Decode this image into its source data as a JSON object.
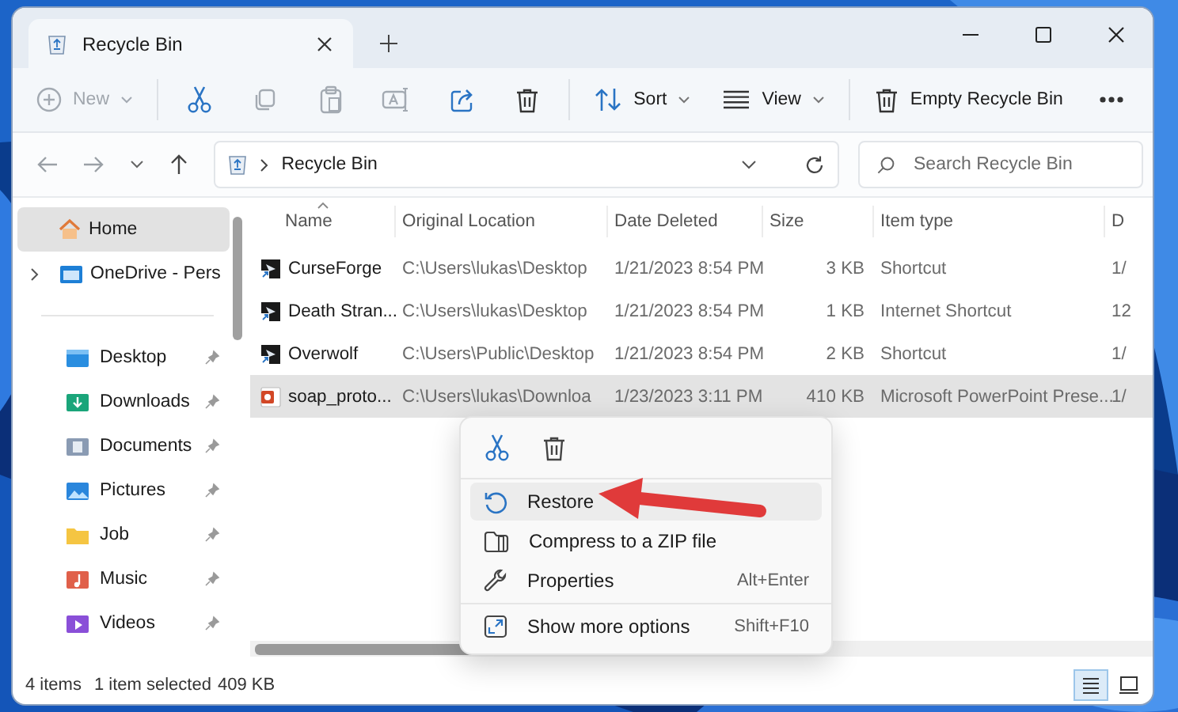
{
  "window": {
    "tab": {
      "title": "Recycle Bin"
    }
  },
  "toolbar": {
    "items": [
      {
        "kind": "new",
        "label": "New",
        "disabled": true
      },
      {
        "kind": "cut",
        "disabled": false
      },
      {
        "kind": "copy",
        "disabled": true
      },
      {
        "kind": "paste",
        "disabled": true
      },
      {
        "kind": "rename",
        "disabled": true
      },
      {
        "kind": "share",
        "disabled": false
      },
      {
        "kind": "delete",
        "disabled": false
      },
      {
        "kind": "sort",
        "label": "Sort",
        "disabled": false
      },
      {
        "kind": "view",
        "label": "View",
        "disabled": false
      },
      {
        "kind": "empty",
        "label": "Empty Recycle Bin",
        "disabled": false
      },
      {
        "kind": "more",
        "disabled": false
      }
    ]
  },
  "address_bar": {
    "path": [
      "Recycle Bin"
    ],
    "search": {
      "placeholder": "Search Recycle Bin"
    }
  },
  "sidebar": {
    "items": [
      {
        "kind": "home",
        "label": "Home",
        "selected": true,
        "pinned": false
      },
      {
        "kind": "cloud",
        "label": "OneDrive - Pers",
        "selected": false,
        "pinned": false,
        "expanded": false
      },
      {
        "kind": "desktop",
        "label": "Desktop",
        "selected": false,
        "pinned": true
      },
      {
        "kind": "downloads",
        "label": "Downloads",
        "selected": false,
        "pinned": true
      },
      {
        "kind": "documents",
        "label": "Documents",
        "selected": false,
        "pinned": true
      },
      {
        "kind": "pictures",
        "label": "Pictures",
        "selected": false,
        "pinned": true
      },
      {
        "kind": "folder",
        "label": "Job",
        "selected": false,
        "pinned": true
      },
      {
        "kind": "music",
        "label": "Music",
        "selected": false,
        "pinned": true
      },
      {
        "kind": "videos",
        "label": "Videos",
        "selected": false,
        "pinned": true
      }
    ]
  },
  "table": {
    "columns": [
      "Name",
      "Original Location",
      "Date Deleted",
      "Size",
      "Item type",
      "D"
    ],
    "rows": [
      {
        "kind": "shortcut",
        "cells": [
          "CurseForge",
          "C:\\Users\\lukas\\Desktop",
          "1/21/2023 8:54 PM",
          "3 KB",
          "Shortcut",
          "1/"
        ],
        "selected": false
      },
      {
        "kind": "shortcut",
        "cells": [
          "Death Stran...",
          "C:\\Users\\lukas\\Desktop",
          "1/21/2023 8:54 PM",
          "1 KB",
          "Internet Shortcut",
          "12"
        ],
        "selected": false
      },
      {
        "kind": "shortcut",
        "cells": [
          "Overwolf",
          "C:\\Users\\Public\\Desktop",
          "1/21/2023 8:54 PM",
          "2 KB",
          "Shortcut",
          "1/"
        ],
        "selected": false
      },
      {
        "kind": "slides",
        "cells": [
          "soap_proto...",
          "C:\\Users\\lukas\\Downloa",
          "1/23/2023 3:11 PM",
          "410 KB",
          "Microsoft PowerPoint Prese...",
          "1/"
        ],
        "selected": true
      }
    ]
  },
  "context_menu": {
    "actions": [
      {
        "kind": "cut"
      },
      {
        "kind": "delete"
      }
    ],
    "items": [
      {
        "kind": "restore",
        "label": "Restore",
        "selected": true
      },
      {
        "kind": "compress",
        "label": "Compress to a ZIP file",
        "selected": false
      },
      {
        "kind": "properties",
        "label": "Properties",
        "shortcut": "Alt+Enter",
        "selected": false
      },
      {
        "kind": "more",
        "label": "Show more options",
        "shortcut": "Shift+F10",
        "selected": false
      }
    ]
  },
  "status_bar": {
    "count": "4 items",
    "selection": "1 item selected",
    "size": "409 KB",
    "views": [
      {
        "kind": "details",
        "selected": true
      },
      {
        "kind": "tiles",
        "selected": false
      }
    ]
  }
}
